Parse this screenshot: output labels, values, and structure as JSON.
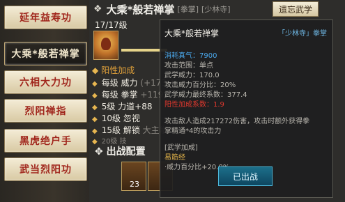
{
  "sidebar": {
    "items": [
      {
        "label": "延年益寿功",
        "active": false
      },
      {
        "label": "大乘*般若禅掌",
        "active": true
      },
      {
        "label": "六相大力功",
        "active": false
      },
      {
        "label": "烈阳禅指",
        "active": false
      },
      {
        "label": "黑虎绝户手",
        "active": false
      },
      {
        "label": "武当烈阳功",
        "active": false
      }
    ]
  },
  "header": {
    "title": "大乘*般若禅掌",
    "type_tag": "[拳掌]",
    "sect_tag": "[少林寺]",
    "forget_button": "遗忘武学"
  },
  "skill": {
    "level": "17/17级",
    "progress": 1.0
  },
  "effects": {
    "bonus_header": "阳性加成",
    "lines": [
      {
        "left": "每级",
        "right": "威力",
        "tail": "(+173.4)"
      },
      {
        "left": "每级",
        "right": "拳掌",
        "tail": "+119)"
      },
      {
        "left": "5级",
        "right": "力道+88",
        "tail": ""
      },
      {
        "left": "10级",
        "right": "忽视",
        "tail": ""
      },
      {
        "left": "15级",
        "right": "解锁",
        "tail": "大主掌"
      },
      {
        "left": "20级",
        "right": "技",
        "tail": ""
      }
    ]
  },
  "battle_config": {
    "title": "出战配置",
    "slot_badge": "23"
  },
  "tooltip": {
    "name": "大乘*般若禅掌",
    "sect": "「少林寺」拳掌",
    "stats": [
      {
        "label": "消耗真气：7900",
        "color": "blue"
      },
      {
        "label": "攻击范围：单点",
        "color": "grey"
      },
      {
        "label": "武学威力：170.0",
        "color": "grey"
      },
      {
        "label": "攻击威力百分比：20%",
        "color": "grey"
      },
      {
        "label": "武学威力最终系数：377.4",
        "color": "grey"
      },
      {
        "label": "阳性加成系数：1.9",
        "color": "red"
      }
    ],
    "desc_line1": "攻击敌人造成217272伤害，攻击时额外获得拳",
    "desc_line2": "掌精通*4的攻击力",
    "bonus_title": "[武学加成]",
    "bonus_skill": "易筋经",
    "bonus_value": "·威力百分比+20.0%",
    "status_button": "已出战"
  },
  "colors": {
    "accent_red": "#a0251b",
    "tooltip_blue": "#4aa8ec",
    "warning_red": "#e2392e",
    "gold": "#e0b24a"
  }
}
